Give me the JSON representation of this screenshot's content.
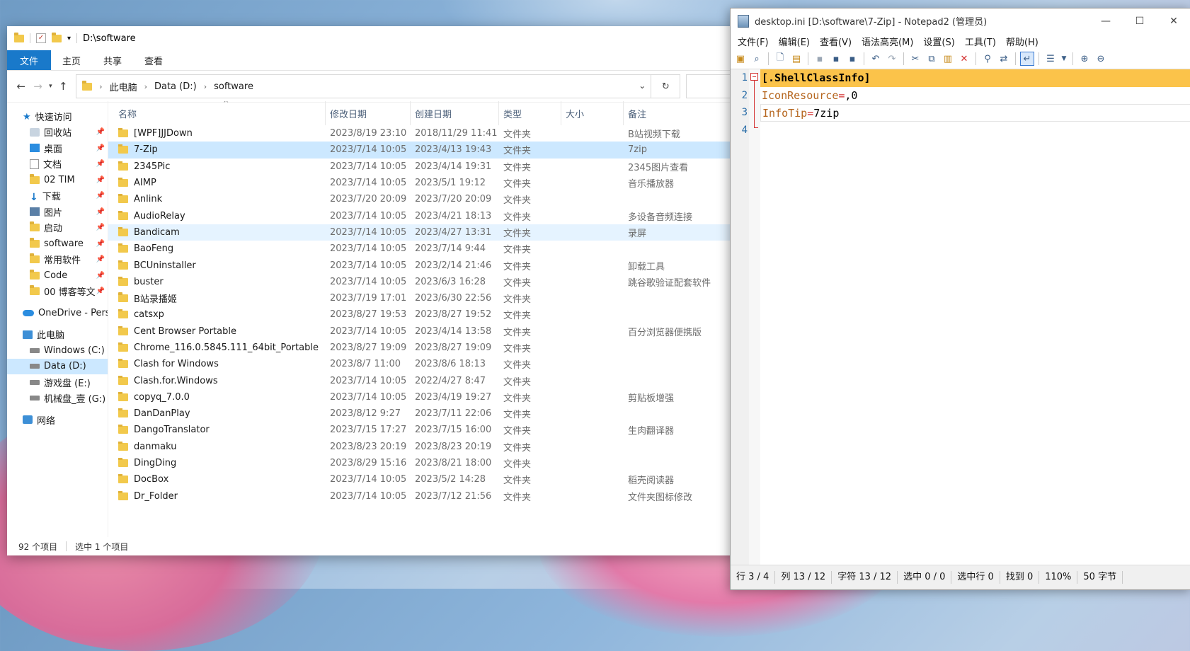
{
  "explorer": {
    "title": "D:\\software",
    "ribbon_tabs": [
      "文件",
      "主页",
      "共享",
      "查看"
    ],
    "breadcrumb": [
      "此电脑",
      "Data (D:)",
      "software"
    ],
    "nav": {
      "quick_access": "快速访问",
      "pinned": [
        "回收站",
        "桌面",
        "文档",
        "02 TIM",
        "下载",
        "图片",
        "启动",
        "software",
        "常用软件",
        "Code",
        "00 博客等文"
      ],
      "onedrive": "OneDrive - Pers",
      "this_pc": "此电脑",
      "drives": [
        "Windows (C:)",
        "Data (D:)",
        "游戏盘 (E:)",
        "机械盘_壹 (G:)"
      ],
      "network": "网络"
    },
    "columns": {
      "name": "名称",
      "modified": "修改日期",
      "created": "创建日期",
      "type": "类型",
      "size": "大小",
      "note": "备注"
    },
    "rows": [
      {
        "name": "[WPF]JJDown",
        "modified": "2023/8/19 23:10",
        "created": "2018/11/29 11:41",
        "type": "文件夹",
        "note": "B站视频下载"
      },
      {
        "name": "7-Zip",
        "modified": "2023/7/14 10:05",
        "created": "2023/4/13 19:43",
        "type": "文件夹",
        "note": "7zip"
      },
      {
        "name": "2345Pic",
        "modified": "2023/7/14 10:05",
        "created": "2023/4/14 19:31",
        "type": "文件夹",
        "note": "2345图片查看"
      },
      {
        "name": "AIMP",
        "modified": "2023/7/14 10:05",
        "created": "2023/5/1 19:12",
        "type": "文件夹",
        "note": "音乐播放器"
      },
      {
        "name": "Anlink",
        "modified": "2023/7/20 20:09",
        "created": "2023/7/20 20:09",
        "type": "文件夹",
        "note": ""
      },
      {
        "name": "AudioRelay",
        "modified": "2023/7/14 10:05",
        "created": "2023/4/21 18:13",
        "type": "文件夹",
        "note": "多设备音频连接"
      },
      {
        "name": "Bandicam",
        "modified": "2023/7/14 10:05",
        "created": "2023/4/27 13:31",
        "type": "文件夹",
        "note": "录屏"
      },
      {
        "name": "BaoFeng",
        "modified": "2023/7/14 10:05",
        "created": "2023/7/14 9:44",
        "type": "文件夹",
        "note": ""
      },
      {
        "name": "BCUninstaller",
        "modified": "2023/7/14 10:05",
        "created": "2023/2/14 21:46",
        "type": "文件夹",
        "note": "卸载工具"
      },
      {
        "name": "buster",
        "modified": "2023/7/14 10:05",
        "created": "2023/6/3 16:28",
        "type": "文件夹",
        "note": "跳谷歌验证配套软件"
      },
      {
        "name": "B站录播姬",
        "modified": "2023/7/19 17:01",
        "created": "2023/6/30 22:56",
        "type": "文件夹",
        "note": ""
      },
      {
        "name": "catsxp",
        "modified": "2023/8/27 19:53",
        "created": "2023/8/27 19:52",
        "type": "文件夹",
        "note": ""
      },
      {
        "name": "Cent Browser Portable",
        "modified": "2023/7/14 10:05",
        "created": "2023/4/14 13:58",
        "type": "文件夹",
        "note": "百分浏览器便携版"
      },
      {
        "name": "Chrome_116.0.5845.111_64bit_Portable",
        "modified": "2023/8/27 19:09",
        "created": "2023/8/27 19:09",
        "type": "文件夹",
        "note": ""
      },
      {
        "name": "Clash for Windows",
        "modified": "2023/8/7 11:00",
        "created": "2023/8/6 18:13",
        "type": "文件夹",
        "note": ""
      },
      {
        "name": "Clash.for.Windows",
        "modified": "2023/7/14 10:05",
        "created": "2022/4/27 8:47",
        "type": "文件夹",
        "note": ""
      },
      {
        "name": "copyq_7.0.0",
        "modified": "2023/7/14 10:05",
        "created": "2023/4/19 19:27",
        "type": "文件夹",
        "note": "剪贴板增强"
      },
      {
        "name": "DanDanPlay",
        "modified": "2023/8/12 9:27",
        "created": "2023/7/11 22:06",
        "type": "文件夹",
        "note": ""
      },
      {
        "name": "DangoTranslator",
        "modified": "2023/7/15 17:27",
        "created": "2023/7/15 16:00",
        "type": "文件夹",
        "note": "生肉翻译器"
      },
      {
        "name": "danmaku",
        "modified": "2023/8/23 20:19",
        "created": "2023/8/23 20:19",
        "type": "文件夹",
        "note": ""
      },
      {
        "name": "DingDing",
        "modified": "2023/8/29 15:16",
        "created": "2023/8/21 18:00",
        "type": "文件夹",
        "note": ""
      },
      {
        "name": "DocBox",
        "modified": "2023/7/14 10:05",
        "created": "2023/5/2 14:28",
        "type": "文件夹",
        "note": "稻壳阅读器"
      },
      {
        "name": "Dr_Folder",
        "modified": "2023/7/14 10:05",
        "created": "2023/7/12 21:56",
        "type": "文件夹",
        "note": "文件夹图标修改"
      }
    ],
    "status": {
      "count": "92 个项目",
      "selected": "选中 1 个项目"
    }
  },
  "notepad": {
    "title": "desktop.ini [D:\\software\\7-Zip] - Notepad2 (管理员)",
    "menu": [
      "文件(F)",
      "编辑(E)",
      "查看(V)",
      "语法高亮(M)",
      "设置(S)",
      "工具(T)",
      "帮助(H)"
    ],
    "line_numbers": [
      "1",
      "2",
      "3",
      "4"
    ],
    "lines": {
      "l1": "[.ShellClassInfo]",
      "l2_key": "IconResource",
      "l2_eq": "=",
      "l2_val": ",0",
      "l3_key": "InfoTip",
      "l3_eq": "=",
      "l3_val": "7zip"
    },
    "status": [
      "行 3 / 4",
      "列 13 / 12",
      "字符 13 / 12",
      "选中 0 / 0",
      "选中行 0",
      "找到 0",
      "110%",
      "50 字节"
    ]
  }
}
